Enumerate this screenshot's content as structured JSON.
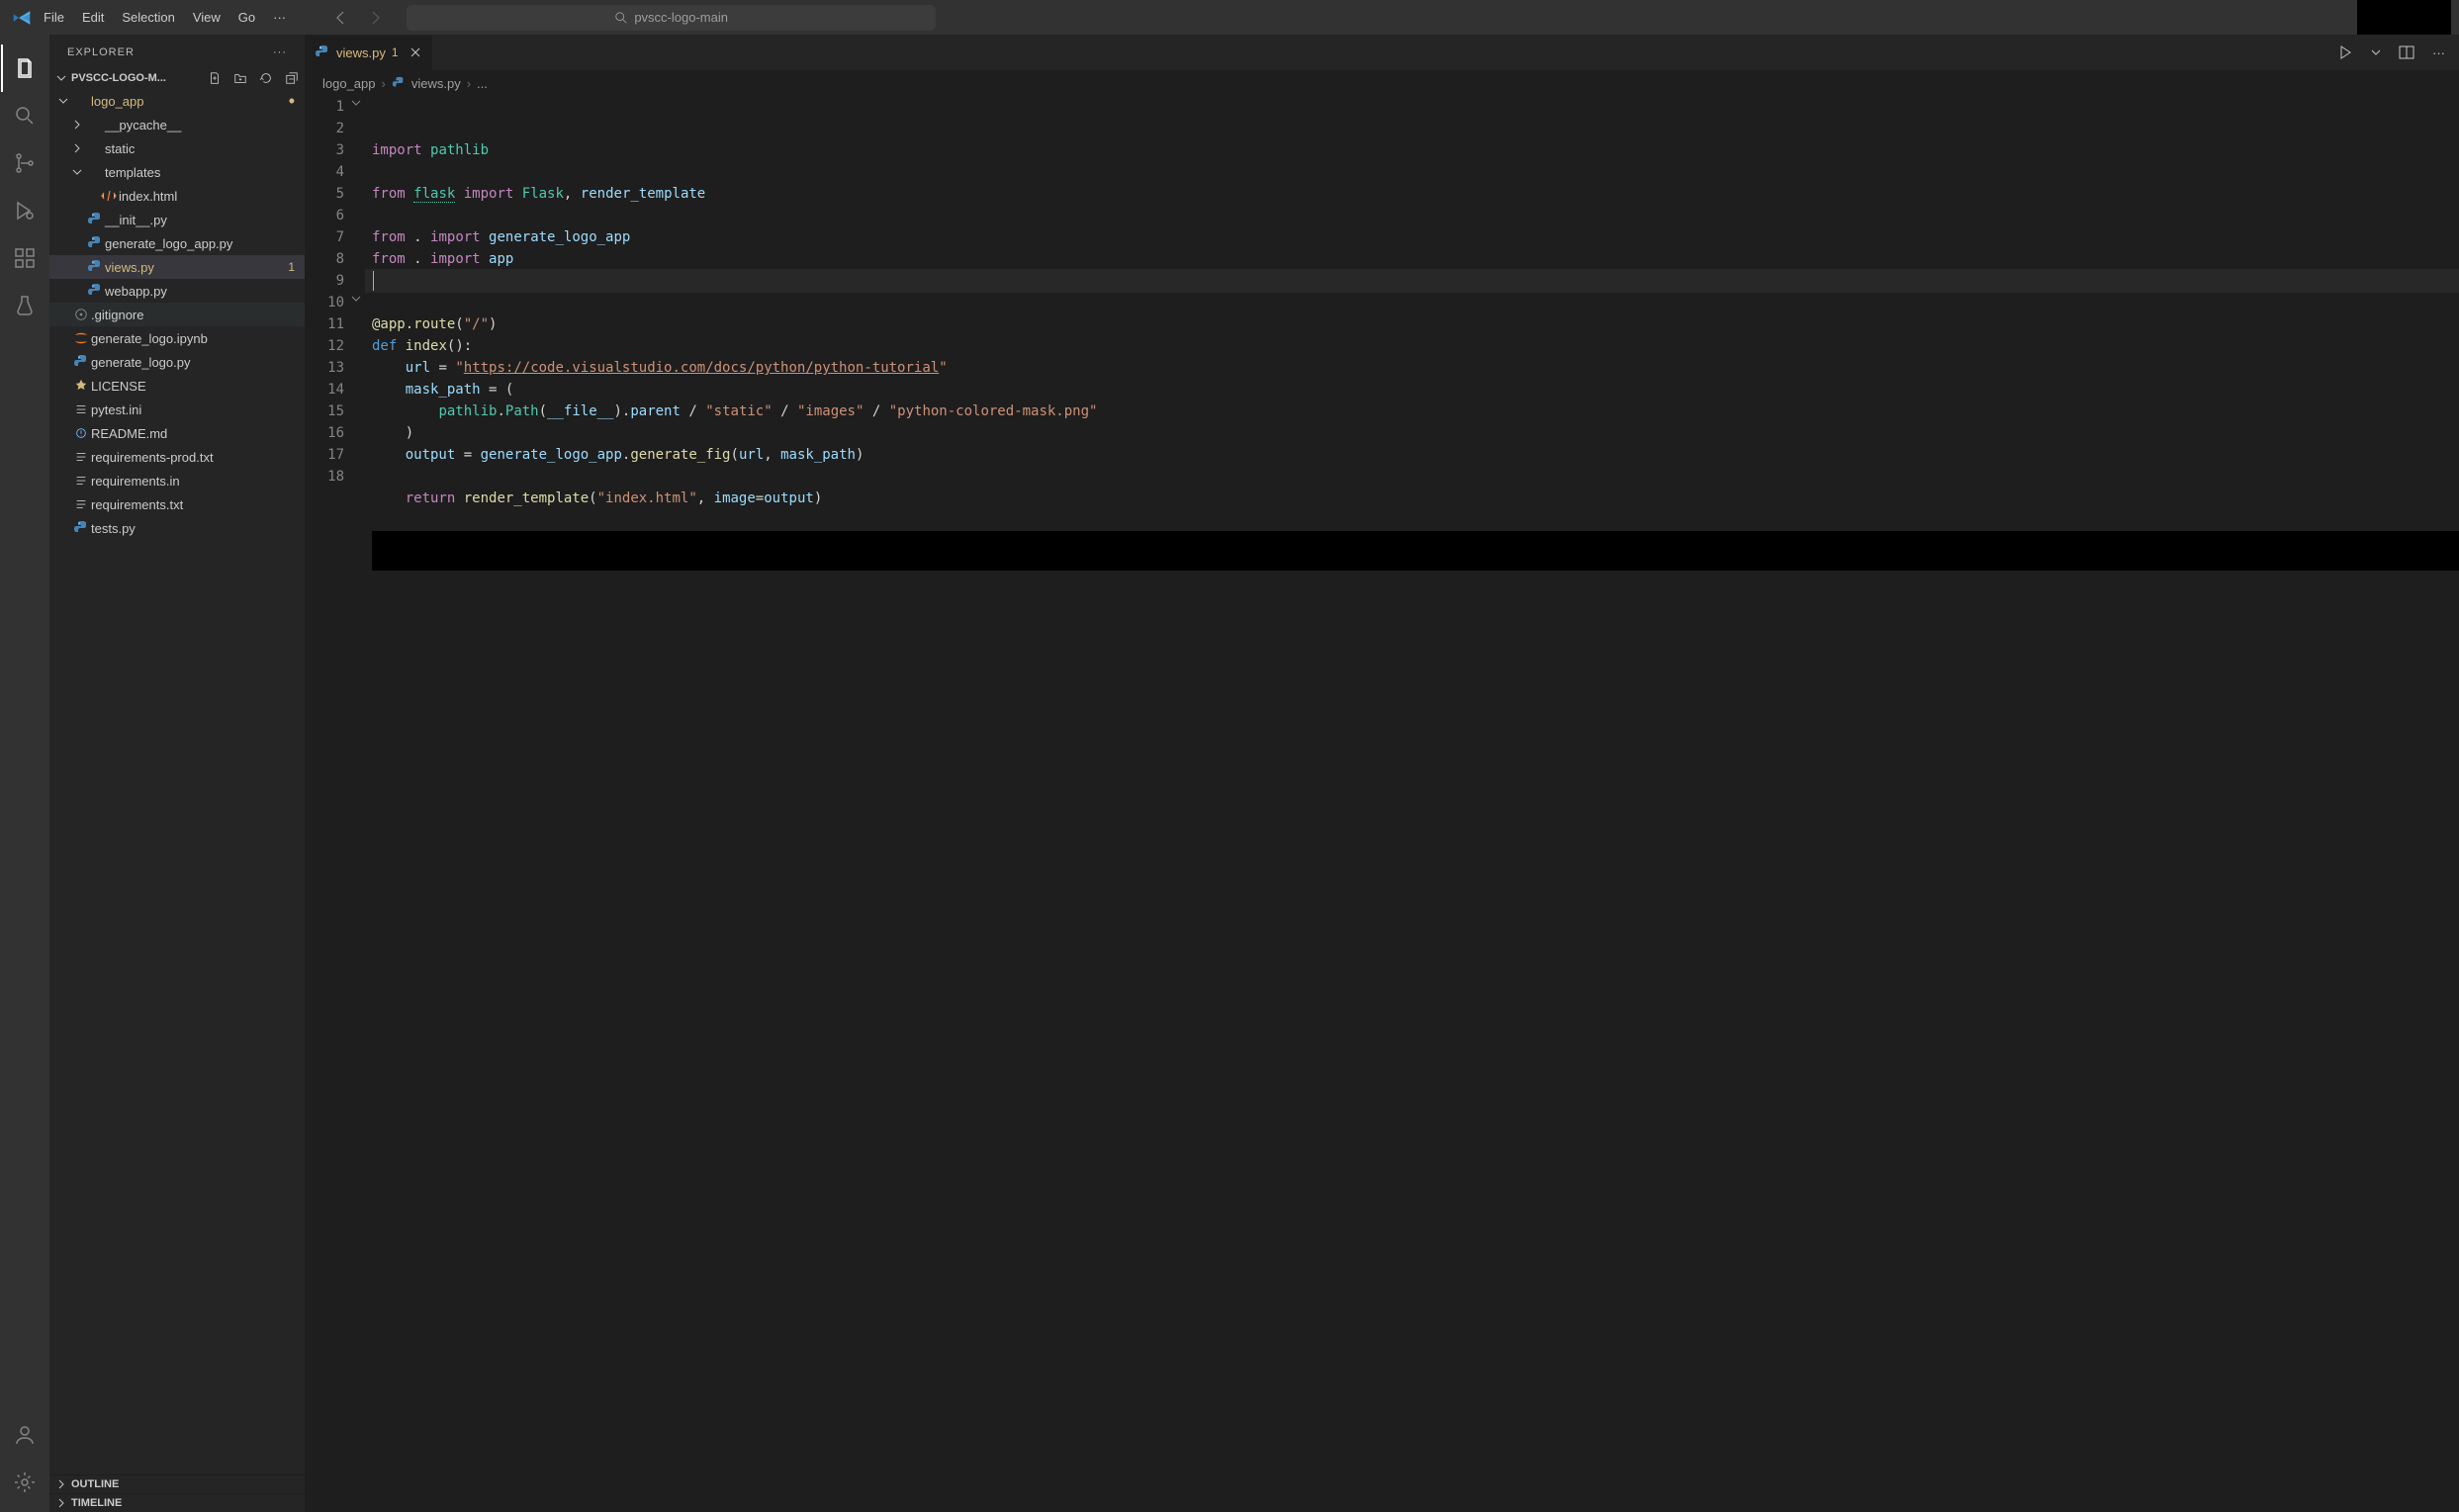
{
  "menu": {
    "items": [
      "File",
      "Edit",
      "Selection",
      "View",
      "Go"
    ]
  },
  "search": {
    "text": "pvscc-logo-main"
  },
  "explorer": {
    "title": "EXPLORER",
    "project": "PVSCC-LOGO-M...",
    "tree": [
      {
        "d": 0,
        "t": "f",
        "open": true,
        "modified": true,
        "label": "logo_app",
        "dot": true
      },
      {
        "d": 1,
        "t": "f",
        "open": false,
        "label": "__pycache__"
      },
      {
        "d": 1,
        "t": "f",
        "open": false,
        "label": "static"
      },
      {
        "d": 1,
        "t": "f",
        "open": true,
        "label": "templates"
      },
      {
        "d": 2,
        "t": "i",
        "icon": "html",
        "label": "index.html"
      },
      {
        "d": 1,
        "t": "i",
        "icon": "py",
        "label": "__init__.py"
      },
      {
        "d": 1,
        "t": "i",
        "icon": "py",
        "label": "generate_logo_app.py"
      },
      {
        "d": 1,
        "t": "i",
        "icon": "py",
        "modified": true,
        "label": "views.py",
        "selected": true,
        "badge": "1"
      },
      {
        "d": 1,
        "t": "i",
        "icon": "py",
        "label": "webapp.py"
      },
      {
        "d": 0,
        "t": "i",
        "icon": "git",
        "label": ".gitignore",
        "hover": true
      },
      {
        "d": 0,
        "t": "i",
        "icon": "ipynb",
        "label": "generate_logo.ipynb"
      },
      {
        "d": 0,
        "t": "i",
        "icon": "py",
        "label": "generate_logo.py"
      },
      {
        "d": 0,
        "t": "i",
        "icon": "lic",
        "label": "LICENSE"
      },
      {
        "d": 0,
        "t": "i",
        "icon": "ini",
        "label": "pytest.ini"
      },
      {
        "d": 0,
        "t": "i",
        "icon": "md",
        "label": "README.md"
      },
      {
        "d": 0,
        "t": "i",
        "icon": "txt",
        "label": "requirements-prod.txt"
      },
      {
        "d": 0,
        "t": "i",
        "icon": "txt",
        "label": "requirements.in"
      },
      {
        "d": 0,
        "t": "i",
        "icon": "txt",
        "label": "requirements.txt"
      },
      {
        "d": 0,
        "t": "i",
        "icon": "py",
        "label": "tests.py"
      }
    ],
    "outline": "OUTLINE",
    "timeline": "TIMELINE"
  },
  "tabs": {
    "open": {
      "label": "views.py",
      "badge": "1"
    }
  },
  "breadcrumb": {
    "a": "logo_app",
    "b": "views.py",
    "c": "..."
  },
  "editor": {
    "lines": [
      {
        "n": 1,
        "fold": true,
        "html": "<span class='kw'>import</span> <span class='mod'>pathlib</span>"
      },
      {
        "n": 2,
        "html": ""
      },
      {
        "n": 3,
        "html": "<span class='kw'>from</span> <span class='mod squiggle'>flask</span> <span class='kw'>import</span> <span class='mod'>Flask</span><span class='pun'>,</span> <span class='var'>render_template</span>"
      },
      {
        "n": 4,
        "html": ""
      },
      {
        "n": 5,
        "html": "<span class='kw'>from</span> <span class='pun'>.</span> <span class='kw'>import</span> <span class='var'>generate_logo_app</span>"
      },
      {
        "n": 6,
        "html": "<span class='kw'>from</span> <span class='pun'>.</span> <span class='kw'>import</span> <span class='var'>app</span>"
      },
      {
        "n": 7,
        "active": true,
        "html": ""
      },
      {
        "n": 8,
        "html": ""
      },
      {
        "n": 9,
        "html": "<span class='fn'>@app.route</span><span class='pun'>(</span><span class='str'>\"/\"</span><span class='pun'>)</span>"
      },
      {
        "n": 10,
        "fold": true,
        "html": "<span class='def'>def</span> <span class='fn'>index</span><span class='pun'>():</span>"
      },
      {
        "n": 11,
        "html": "    <span class='var'>url</span> <span class='pun'>=</span> <span class='str'>\"</span><span class='lnk'>https://code.visualstudio.com/docs/python/python-tutorial</span><span class='str'>\"</span>"
      },
      {
        "n": 12,
        "html": "    <span class='var'>mask_path</span> <span class='pun'>= (</span>"
      },
      {
        "n": 13,
        "html": "        <span class='mod'>pathlib</span><span class='pun'>.</span><span class='mod'>Path</span><span class='pun'>(</span><span class='var'>__file__</span><span class='pun'>).</span><span class='var'>parent</span> <span class='pun'>/</span> <span class='str'>\"static\"</span> <span class='pun'>/</span> <span class='str'>\"images\"</span> <span class='pun'>/</span> <span class='str'>\"python-colored-mask.png\"</span>"
      },
      {
        "n": 14,
        "html": "    <span class='pun'>)</span>"
      },
      {
        "n": 15,
        "html": "    <span class='var'>output</span> <span class='pun'>=</span> <span class='var'>generate_logo_app</span><span class='pun'>.</span><span class='fn'>generate_fig</span><span class='pun'>(</span><span class='var'>url</span><span class='pun'>,</span> <span class='var'>mask_path</span><span class='pun'>)</span>"
      },
      {
        "n": 16,
        "html": ""
      },
      {
        "n": 17,
        "html": "    <span class='kw'>return</span> <span class='fn'>render_template</span><span class='pun'>(</span><span class='str'>\"index.html\"</span><span class='pun'>,</span> <span class='var'>image</span><span class='pun'>=</span><span class='var'>output</span><span class='pun'>)</span>"
      },
      {
        "n": 18,
        "html": ""
      }
    ]
  }
}
